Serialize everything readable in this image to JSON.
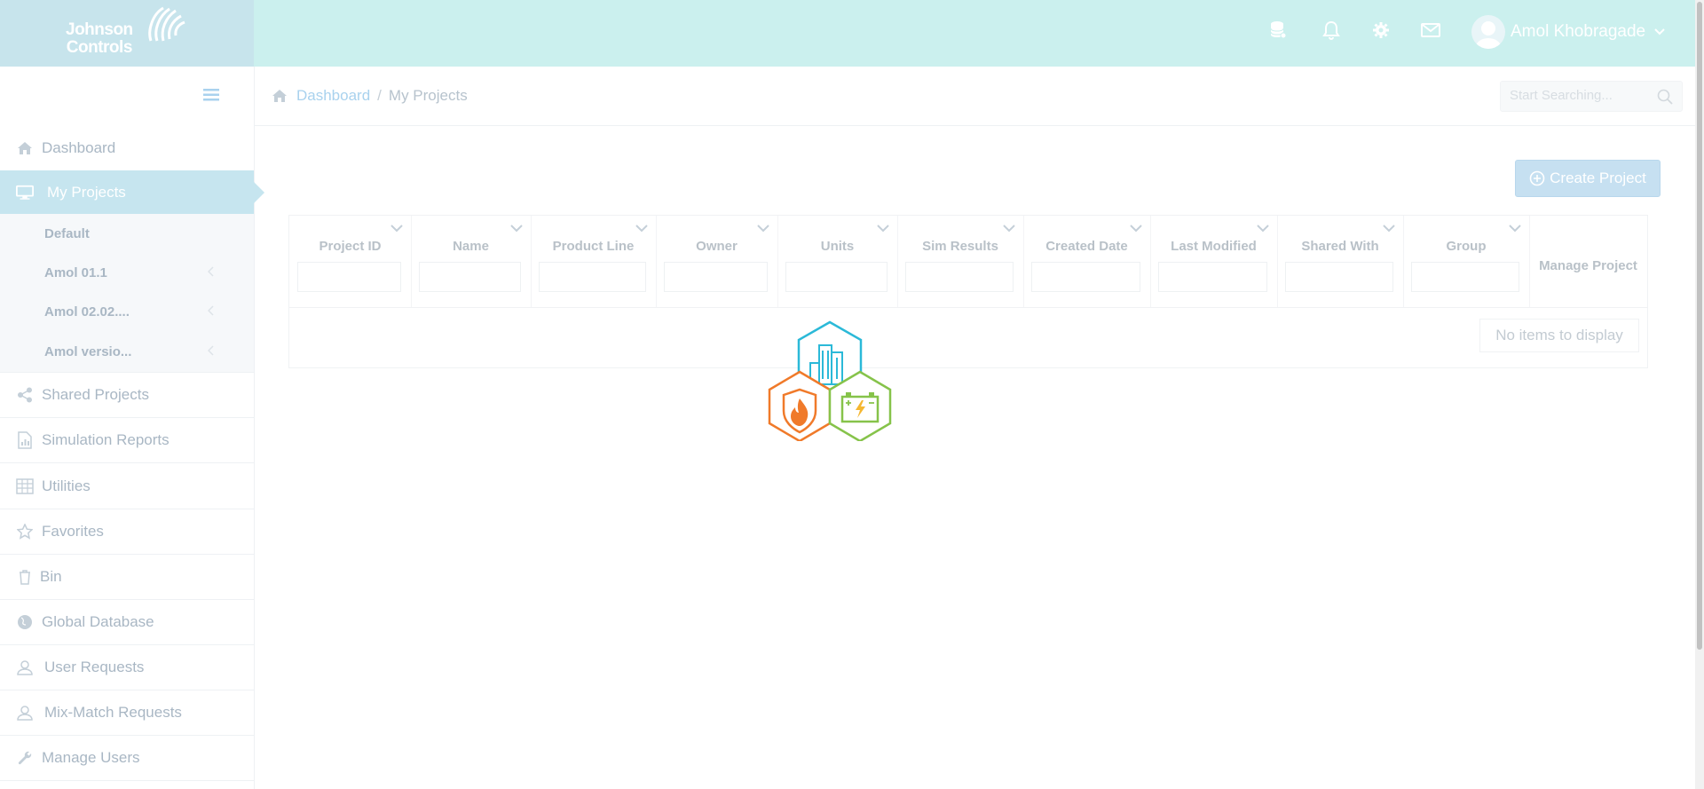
{
  "header": {
    "logo_line1": "Johnson",
    "logo_line2": "Controls",
    "user_name": "Amol Khobragade",
    "brand_color": "#cbf0ee",
    "icons": [
      "database-icon",
      "bell-icon",
      "gear-icon",
      "mail-icon"
    ]
  },
  "sidebar": {
    "items": [
      {
        "label": "Dashboard",
        "icon": "home-icon"
      },
      {
        "label": "My Projects",
        "icon": "monitor-icon",
        "active": true
      },
      {
        "label": "Shared Projects",
        "icon": "share-icon"
      },
      {
        "label": "Simulation Reports",
        "icon": "report-icon"
      },
      {
        "label": "Utilities",
        "icon": "table-icon"
      },
      {
        "label": "Favorites",
        "icon": "star-icon"
      },
      {
        "label": "Bin",
        "icon": "trash-icon"
      },
      {
        "label": "Global Database",
        "icon": "globe-icon"
      },
      {
        "label": "User Requests",
        "icon": "user-icon"
      },
      {
        "label": "Mix-Match Requests",
        "icon": "user-icon"
      },
      {
        "label": "Manage Users",
        "icon": "wrench-icon"
      }
    ],
    "sub_items": [
      {
        "label": "Default"
      },
      {
        "label": "Amol 01.1"
      },
      {
        "label": "Amol 02.02...."
      },
      {
        "label": "Amol versio..."
      }
    ],
    "active_color": "#c6e5ef"
  },
  "breadcrumb": {
    "home": "Dashboard",
    "separator": "/",
    "current": "My Projects"
  },
  "search": {
    "placeholder": "Start Searching..."
  },
  "toolbar": {
    "create_label": "Create Project"
  },
  "grid": {
    "columns": [
      "Project ID",
      "Name",
      "Product Line",
      "Owner",
      "Units",
      "Sim Results",
      "Created Date",
      "Last Modified",
      "Shared With",
      "Group"
    ],
    "manage_column": "Manage Project",
    "empty_text": "No items to display"
  }
}
